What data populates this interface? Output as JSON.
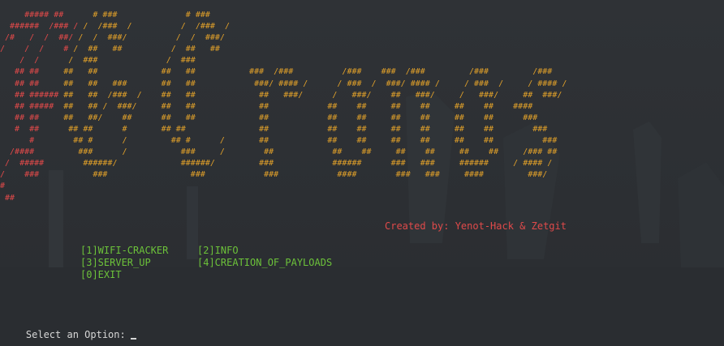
{
  "terminal": {
    "banner_red": [
      "     ##### ##",
      "  ######  /### /",
      " /#   /  /  ##/",
      "/    /  /    #",
      "    /  /",
      "   ## ##",
      "   ## ##",
      "   ## ######",
      "   ## #####",
      "   ## ##",
      "   #  ##",
      "      #",
      "  /####",
      " /  #####",
      "/    ###",
      "#",
      " ##"
    ],
    "banner_orange": [
      "                   # ###              # ###",
      "                 /  /###  /          /  /###  /",
      "                /  /  ###/          /  /  ###/",
      "               /  ##   ##          /  ##   ##",
      "              /  ###              /  ###",
      "             ##   ##             ##   ##           ###  /###          /###    ###  /###         /###         /###",
      "             ##   ##   ###       ##   ##            ###/ #### /      / ###  /  ###/ #### /     / ###  /     / #### /",
      "             ##   ##  /###  /    ##   ##             ##   ###/      /   ###/    ##   ###/     /   ###/     ##  ###/",
      "             ##   ## /  ###/     ##   ##             ##            ##    ##     ##    ##     ##    ##    ####",
      "             ##   ##/    ##      ##   ##             ##            ##    ##     ##    ##     ##    ##      ###",
      "              ## ##      #       ## ##               ##            ##    ##     ##    ##     ##    ##        ###",
      "               ## #      /         ## #      /       ##            ##    ##     ##    ##     ##    ##          ###",
      "                ###      /           ###     /        ##            ##    ##     ##    ##     ##    ##     /### ##",
      "                 ######/             ######/         ###            ######      ###   ###     ######     / #### /",
      "                   ###                 ###            ###            ####        ###   ###     ####         ###/"
    ],
    "credit": "Created by: Yenot-Hack & Zetgit",
    "menu": [
      [
        "[1]WIFI-CRACKER",
        "[2]INFO"
      ],
      [
        "[3]SERVER_UP",
        "[4]CREATION_OF_PAYLOADS"
      ],
      [
        "[0]EXIT"
      ]
    ],
    "prompt": "Select an Option:"
  }
}
